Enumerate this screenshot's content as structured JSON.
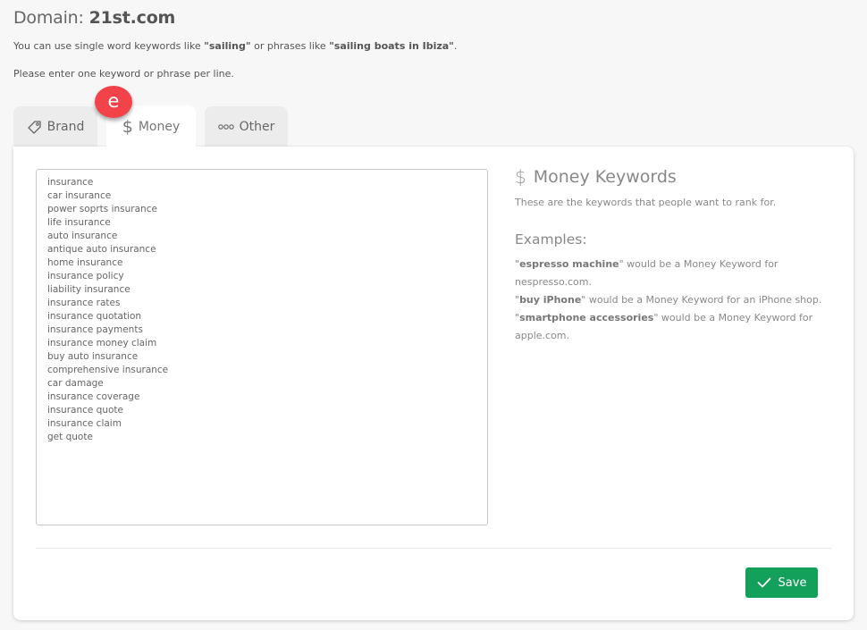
{
  "header": {
    "domain_label": "Domain:",
    "domain_value": "21st.com",
    "intro_prefix": "You can use single word keywords like ",
    "intro_example1": "\"sailing\"",
    "intro_middle": " or phrases like ",
    "intro_example2": "\"sailing boats in Ibiza\"",
    "intro_suffix": ".",
    "instruction": "Please enter one keyword or phrase per line."
  },
  "badge": {
    "label": "e",
    "color": "#f2424a"
  },
  "tabs": [
    {
      "label": "Brand",
      "icon": "tag-icon",
      "active": false
    },
    {
      "label": "Money",
      "icon": "dollar-icon",
      "active": true
    },
    {
      "label": "Other",
      "icon": "dots-icon",
      "active": false
    }
  ],
  "keywords": [
    "insurance",
    "car insurance",
    "power soprts insurance",
    "life insurance",
    "auto insurance",
    "antique auto insurance",
    "home insurance",
    "insurance policy",
    "liability insurance",
    "insurance rates",
    "insurance quotation",
    "insurance payments",
    "insurance money claim",
    "buy auto insurance",
    "comprehensive insurance",
    "car damage",
    "insurance coverage",
    "insurance quote",
    "insurance claim",
    "get quote"
  ],
  "help": {
    "icon": "$",
    "title": "Money Keywords",
    "subtitle": "These are the keywords that people want to rank for.",
    "examples_heading": "Examples:",
    "examples": [
      {
        "keyword": "espresso machine",
        "text": "\" would be a Money Keyword for nespresso.com."
      },
      {
        "keyword": "buy iPhone",
        "text": "\" would be a Money Keyword for an iPhone shop."
      },
      {
        "keyword": "smartphone accessories",
        "text": "\" would be a Money Keyword for apple.com."
      }
    ]
  },
  "footer": {
    "save_label": "Save",
    "save_color": "#13a05a"
  }
}
